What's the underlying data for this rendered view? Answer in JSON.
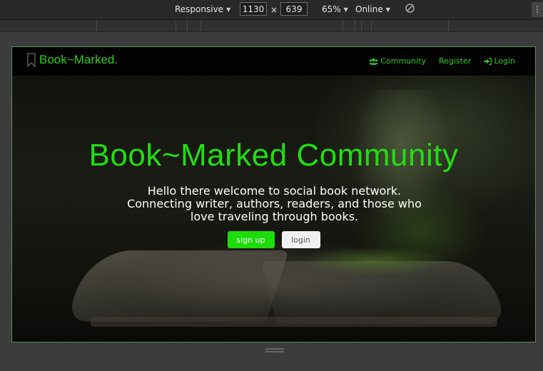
{
  "devtools": {
    "device": "Responsive",
    "width": "1130",
    "height": "639",
    "times": "×",
    "zoom": "65%",
    "network": "Online"
  },
  "navbar": {
    "brand": "Book~Marked.",
    "links": [
      {
        "label": "Community",
        "icon": "users-icon"
      },
      {
        "label": "Register"
      },
      {
        "label": "Login",
        "icon": "sign-in-icon"
      }
    ]
  },
  "hero": {
    "title": "Book~Marked Community",
    "subtitle": "Hello there welcome to social book network. Connecting writer, authors, readers, and those who love traveling through books.",
    "signup_label": "sign up",
    "login_label": "login"
  },
  "colors": {
    "brand_green": "#2ecc1f",
    "button_green": "#1edc0c"
  }
}
